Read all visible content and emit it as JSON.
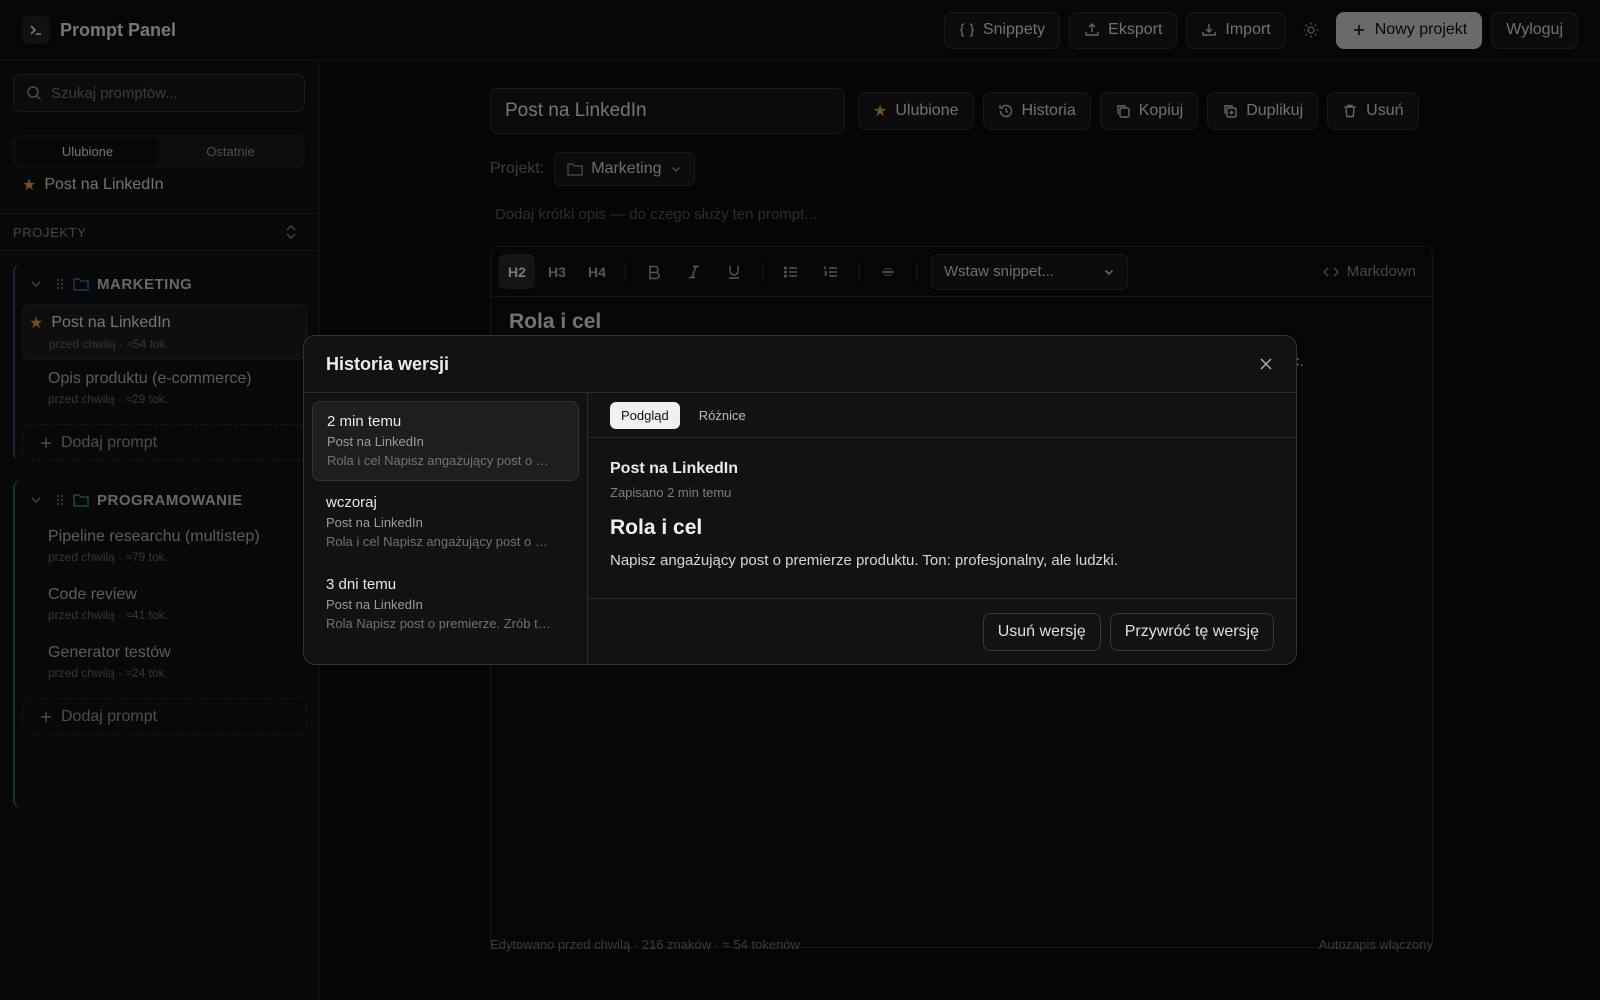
{
  "app": {
    "title": "Prompt Panel"
  },
  "topbar": {
    "snippets": "Snippety",
    "export": "Eksport",
    "import": "Import",
    "new_project": "Nowy projekt",
    "logout": "Wyloguj"
  },
  "sidebar": {
    "search_placeholder": "Szukaj promptów...",
    "tabs": [
      "Ulubione",
      "Ostatnie"
    ],
    "favorites": [
      {
        "name": "Post na LinkedIn"
      }
    ],
    "projects_label": "PROJEKTY",
    "projects": [
      {
        "name": "MARKETING",
        "prompts": [
          {
            "name": "Post na LinkedIn",
            "meta": "przed chwilą · ≈54 tok."
          },
          {
            "name": "Opis produktu (e-commerce)",
            "meta": "przed chwilą · ≈29 tok."
          }
        ]
      },
      {
        "name": "PROGRAMOWANIE",
        "prompts": [
          {
            "name": "Pipeline researchu (multistep)",
            "meta": "przed chwilą · ≈79 tok."
          },
          {
            "name": "Code review",
            "meta": "przed chwilą · ≈41 tok."
          },
          {
            "name": "Generator testów",
            "meta": "przed chwilą · ≈24 tok."
          }
        ]
      }
    ],
    "add_prompt": "Dodaj prompt"
  },
  "editor": {
    "title": "Post na LinkedIn",
    "actions": [
      "Ulubione",
      "Historia",
      "Kopiuj",
      "Duplikuj",
      "Usuń"
    ],
    "project_label": "Projekt:",
    "project_value": "Marketing",
    "description_placeholder": "Dodaj krótki opis — do czego służy ten prompt...",
    "toolbar": {
      "h2": "H2",
      "h3": "H3",
      "h4": "H4",
      "snippet_placeholder": "Wstaw snippet...",
      "markdown": "Markdown"
    },
    "heading": "Rola i cel",
    "visible_tail": "iec.",
    "footer_left": "Edytowano przed chwilą · 216 znaków · ≈ 54 tokenów",
    "footer_right": "Autozapis włączony"
  },
  "modal": {
    "title": "Historia wersji",
    "versions": [
      {
        "when": "2 min temu",
        "title": "Post na LinkedIn",
        "excerpt": "Rola i cel Napisz angażujący post o premierze produktu."
      },
      {
        "when": "wczoraj",
        "title": "Post na LinkedIn",
        "excerpt": "Rola i cel Napisz angażujący post o premierze produktu."
      },
      {
        "when": "3 dni temu",
        "title": "Post na LinkedIn",
        "excerpt": "Rola Napisz post o premierze. Zrób to krótko."
      }
    ],
    "tabs": [
      "Podgląd",
      "Różnice"
    ],
    "preview": {
      "title": "Post na LinkedIn",
      "saved": "Zapisano 2 min temu",
      "heading": "Rola i cel",
      "body": "Napisz angażujący post o premierze produktu. Ton: profesjonalny, ale ludzki."
    },
    "delete_version": "Usuń wersję",
    "restore_version": "Przywróć tę wersję"
  },
  "colors": {
    "accent_star": "#e0a13a",
    "marketing": "#2c4c8a",
    "programming": "#1f6f52"
  }
}
